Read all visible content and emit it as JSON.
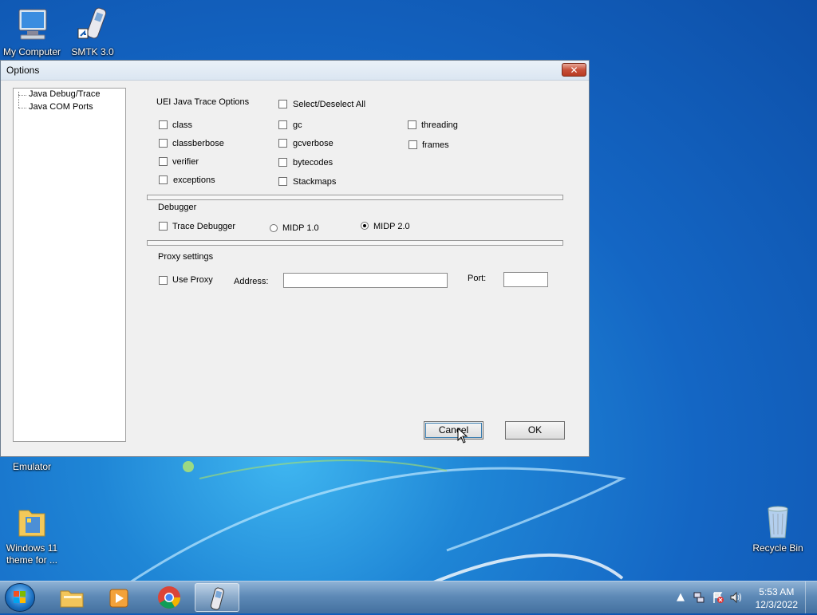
{
  "desktop": {
    "icons": {
      "my_computer": "My Computer",
      "smtk": "SMTK 3.0",
      "emulator": "Emulator",
      "win11_line1": "Windows 11",
      "win11_line2": "theme for ...",
      "recycle_bin": "Recycle Bin"
    }
  },
  "dialog": {
    "title": "Options",
    "close_glyph": "✕",
    "tree": [
      "Java Debug/Trace",
      "Java COM Ports"
    ],
    "trace": {
      "heading": "UEI Java Trace Options",
      "select_all": "Select/Deselect  All",
      "col1": [
        "class",
        "classberbose",
        "verifier",
        "exceptions"
      ],
      "col2": [
        "gc",
        "gcverbose",
        "bytecodes",
        "Stackmaps"
      ],
      "col3": [
        "threading",
        "frames"
      ]
    },
    "debugger": {
      "heading": "Debugger",
      "trace_debugger": "Trace Debugger",
      "midp1": "MIDP 1.0",
      "midp2": "MIDP 2.0",
      "selected": "MIDP 2.0"
    },
    "proxy": {
      "heading": "Proxy settings",
      "use_proxy": "Use Proxy",
      "address_label": "Address:",
      "address_value": "",
      "port_label": "Port:",
      "port_value": ""
    },
    "buttons": {
      "cancel": "Cancel",
      "ok": "OK"
    }
  },
  "taskbar": {
    "time": "5:53 AM",
    "date": "12/3/2022",
    "tray_arrow": "▲"
  },
  "colors": {
    "desktop": "#1466c4",
    "dialog_bg": "#f0f0f0",
    "close_red": "#c7503a"
  }
}
